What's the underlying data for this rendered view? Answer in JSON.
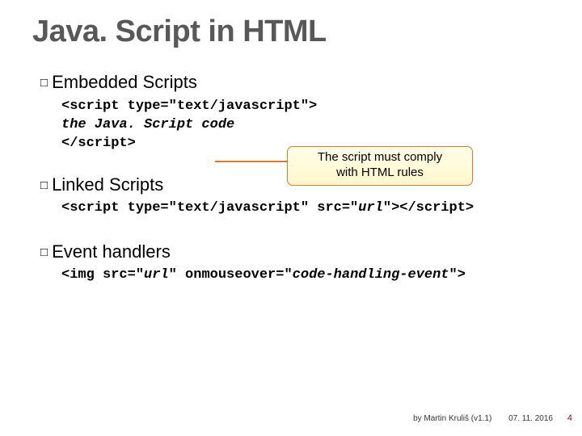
{
  "title": "Java. Script in HTML",
  "sections": {
    "embedded": {
      "label": "Embedded",
      "suffix": " Scripts"
    },
    "linked": {
      "label": "Linked",
      "suffix": " Scripts"
    },
    "event": {
      "label": "Event",
      "suffix": " handlers"
    }
  },
  "code": {
    "embedded_open": "<script type=\"text/javascript\">",
    "embedded_body_indent": "    ",
    "embedded_body": "the Java. Script code",
    "embedded_close": "</script>",
    "linked_pre": "<script type=\"text/javascript\" src=\"",
    "linked_url": "url",
    "linked_post": "\"></script>",
    "event_pre": "<img src=\"",
    "event_url": "url",
    "event_mid": "\" onmouseover=\"",
    "event_handler": "code-handling-event",
    "event_post": "\">"
  },
  "callout": {
    "line1": "The script must comply",
    "line2": "with HTML rules"
  },
  "footer": {
    "by": "by Martin Kruliš (v1.1)",
    "date": "07. 11. 2016",
    "page": "4"
  }
}
